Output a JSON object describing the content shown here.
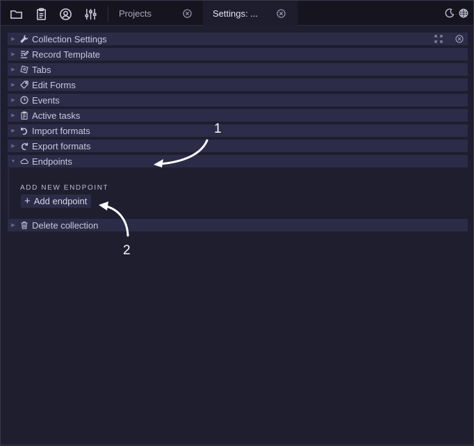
{
  "topbar": {
    "icons": [
      "folder-icon",
      "clipboard-icon",
      "user-circle-icon",
      "sliders-icon"
    ],
    "tabs": [
      {
        "label": "Projects",
        "active": false
      },
      {
        "label": "Settings: ...",
        "active": true
      }
    ],
    "right_icons": [
      "moon-icon",
      "globe-icon"
    ]
  },
  "panel": {
    "rows": [
      {
        "label": "Collection Settings",
        "icon": "wrench-icon",
        "expanded": false
      },
      {
        "label": "Record Template",
        "icon": "edit-icon",
        "expanded": false
      },
      {
        "label": "Tabs",
        "icon": "tabs-icon",
        "expanded": false
      },
      {
        "label": "Edit Forms",
        "icon": "tag-icon",
        "expanded": false
      },
      {
        "label": "Events",
        "icon": "clock-icon",
        "expanded": false
      },
      {
        "label": "Active tasks",
        "icon": "clipboard-icon",
        "expanded": false
      },
      {
        "label": "Import formats",
        "icon": "undo-icon",
        "expanded": false
      },
      {
        "label": "Export formats",
        "icon": "redo-icon",
        "expanded": false
      },
      {
        "label": "Endpoints",
        "icon": "cloud-icon",
        "expanded": true
      }
    ],
    "endpoints": {
      "section_title": "ADD NEW ENDPOINT",
      "add_button": "Add endpoint"
    },
    "delete_row": {
      "label": "Delete collection",
      "icon": "trash-icon"
    }
  },
  "annotations": {
    "one": "1",
    "two": "2",
    "color": "#ffffff"
  },
  "colors": {
    "background": "#1e1d2e",
    "row": "#2d2c48",
    "topbar": "#16151f"
  }
}
